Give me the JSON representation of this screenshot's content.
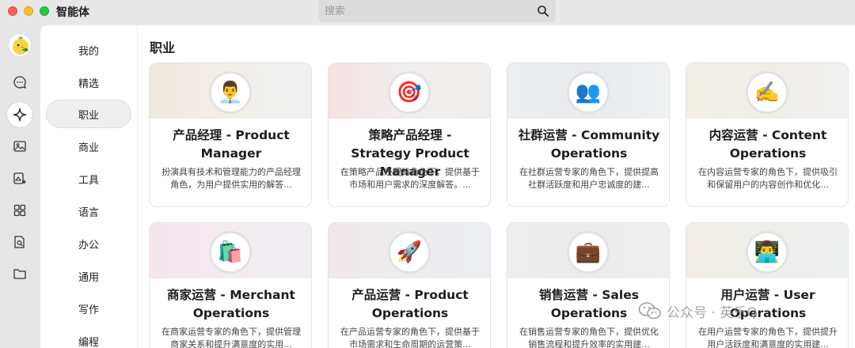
{
  "window": {
    "title": "智能体"
  },
  "search": {
    "placeholder": "搜索"
  },
  "rail": {
    "items": [
      {
        "icon": "chat-icon"
      },
      {
        "icon": "sparkle-icon",
        "active": true
      },
      {
        "icon": "image-icon"
      },
      {
        "icon": "image-edit-icon"
      },
      {
        "icon": "grid-icon"
      },
      {
        "icon": "doc-search-icon"
      },
      {
        "icon": "folder-icon"
      }
    ]
  },
  "categories": [
    "我的",
    "精选",
    "职业",
    "商业",
    "工具",
    "语言",
    "办公",
    "通用",
    "写作",
    "编程"
  ],
  "active_category": "职业",
  "section": {
    "title": "职业"
  },
  "cards": [
    {
      "emoji": "👨‍💼",
      "name": "产品经理 - Product Manager",
      "desc": "扮演具有技术和管理能力的产品经理角色，为用户提供实用的解答..."
    },
    {
      "emoji": "🎯",
      "name": "策略产品经理 - Strategy Product Manager",
      "desc": "在策略产品经理的角色下，提供基于市场和用户需求的深度解答。..."
    },
    {
      "emoji": "👥",
      "name": "社群运营 - Community Operations",
      "desc": "在社群运营专家的角色下，提供提高社群活跃度和用户忠诚度的建..."
    },
    {
      "emoji": "✍️",
      "name": "内容运营 - Content Operations",
      "desc": "在内容运营专家的角色下，提供吸引和保留用户的内容创作和优化..."
    },
    {
      "emoji": "🛍️",
      "name": "商家运营 - Merchant Operations",
      "desc": "在商家运营专家的角色下，提供管理商家关系和提升满意度的实用..."
    },
    {
      "emoji": "🚀",
      "name": "产品运营 - Product Operations",
      "desc": "在产品运营专家的角色下，提供基于市场需求和生命周期的运营策..."
    },
    {
      "emoji": "💼",
      "name": "销售运营 - Sales Operations",
      "desc": "在销售运营专家的角色下，提供优化销售流程和提升效率的实用建..."
    },
    {
      "emoji": "👨‍💻",
      "name": "用户运营 - User Operations",
      "desc": "在用户运营专家的角色下，提供提升用户活跃度和满意度的实用建..."
    }
  ],
  "watermark": {
    "text": "公众号 · 英乐Q"
  },
  "colors": {
    "red": "#ff5f57",
    "yellow": "#febc2e",
    "green": "#28c840"
  }
}
